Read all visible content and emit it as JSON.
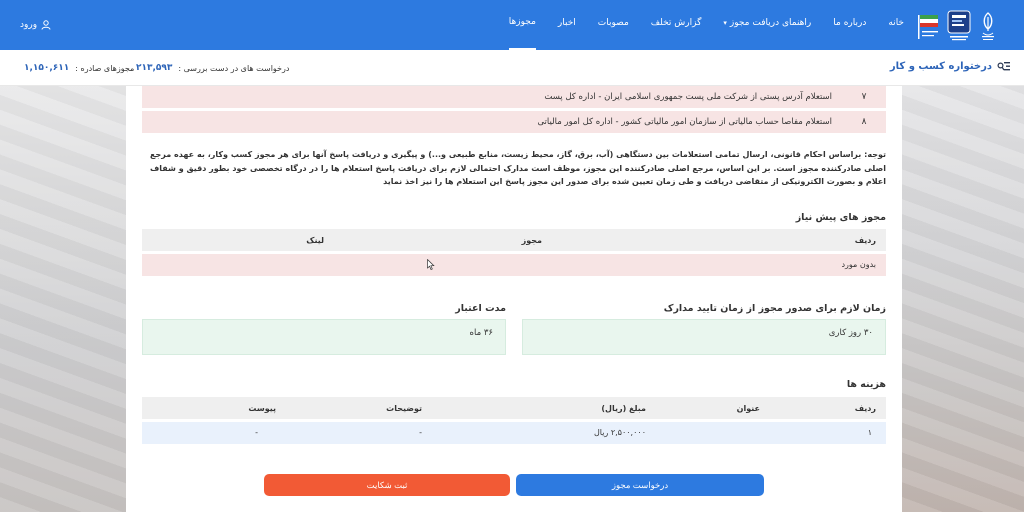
{
  "nav": {
    "items": [
      {
        "label": "خانه"
      },
      {
        "label": "درباره ما"
      },
      {
        "label": "راهنمای دریافت مجوز",
        "caret": "▾"
      },
      {
        "label": "گزارش تخلف"
      },
      {
        "label": "مصوبات"
      },
      {
        "label": "اخبار"
      },
      {
        "label": "مجوزها",
        "active": true
      }
    ],
    "login_label": "ورود",
    "colors": {
      "bar": "#2d7ae0",
      "accent": "#2d64b8"
    }
  },
  "status": {
    "title": "درختواره کسب و کار",
    "pending_label": "درخواست های در دست بررسی :",
    "pending_value": "۲۱۳,۵۹۳",
    "issued_label": "مجوزهای صادره :",
    "issued_value": "۱,۱۵۰,۶۱۱"
  },
  "inquiries": [
    {
      "num": "۷",
      "text": "استعلام آدرس پستی از شرکت ملی پست جمهوری اسلامی ایران - اداره کل پست"
    },
    {
      "num": "۸",
      "text": "استعلام مفاصا حساب مالیاتی از سازمان امور مالیاتی کشور - اداره کل امور مالیاتی"
    }
  ],
  "note": "توجه: براساس احکام قانونی، ارسال تمامی استعلامات بین دستگاهی (آب، برق، گاز، محیط زیست، منابع طبیعی و...) و پیگیری و دریافت پاسخ آنها برای هر مجوز کسب وکار، به عهده مرجع اصلی صادرکننده مجوز است. بر این اساس، مرجع اصلی صادرکننده این مجوز، موظف است مدارک احتمالی لازم برای دریافت پاسخ استعلام ها را در درگاه تخصصی خود بطور دقیق و شفاف اعلام و بصورت الکترونیکی از متقاضی دریافت و طی زمان تعیین شده برای صدور این مجوز پاسخ این استعلام ها را نیز اخذ نماید",
  "prerequisites": {
    "title": "مجوز های پیش نیاز",
    "headers": {
      "row": "ردیف",
      "permit": "مجوز",
      "link": "لینک"
    },
    "empty_text": "بدون مورد"
  },
  "timing": {
    "issue_time_title": "زمان لازم برای صدور مجوز از زمان تایید مدارک",
    "issue_time_value": "۳۰ روز کاری",
    "validity_title": "مدت اعتبار",
    "validity_value": "۳۶ ماه"
  },
  "costs": {
    "title": "هزینه ها",
    "headers": {
      "row": "ردیف",
      "title": "عنوان",
      "amount": "مبلغ (ریال)",
      "desc": "توضیحات",
      "attach": "پیوست"
    },
    "rows": [
      {
        "row": "۱",
        "title": "",
        "amount": "۲,۵۰۰,۰۰۰ ریال",
        "desc": "-",
        "attach": "-"
      }
    ]
  },
  "actions": {
    "request_label": "درخواست مجوز",
    "complaint_label": "ثبت شکایت",
    "colors": {
      "request": "#2d7ae0",
      "complaint": "#f25a35"
    }
  }
}
